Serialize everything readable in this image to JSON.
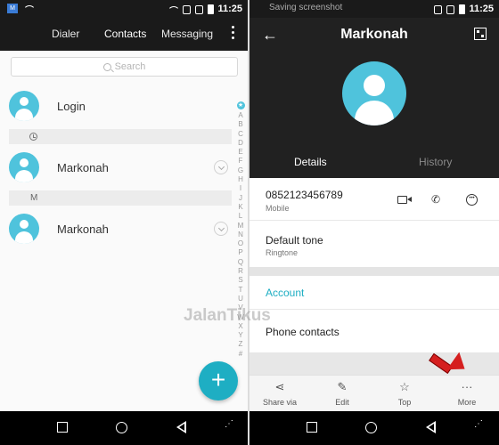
{
  "left": {
    "status": {
      "time": "11:25",
      "badge": "M"
    },
    "tabs": [
      {
        "label": "Dialer"
      },
      {
        "label": "Contacts"
      },
      {
        "label": "Messaging"
      }
    ],
    "search_placeholder": "Search",
    "contacts": [
      {
        "name": "Login"
      },
      {
        "name": "Markonah"
      },
      {
        "name": "Markonah"
      }
    ],
    "section_m": "M",
    "index_letters": "ABCDEFGHIJKLMNOPQRSTUVWXYZ#",
    "fab": "+"
  },
  "right": {
    "status": {
      "time": "11:25",
      "notice": "Saving screenshot"
    },
    "title": "Markonah",
    "tabs": {
      "details": "Details",
      "history": "History"
    },
    "phone": {
      "number": "0852123456789",
      "type": "Mobile"
    },
    "tone": {
      "label": "Default tone",
      "sub": "Ringtone"
    },
    "account_header": "Account",
    "account_value": "Phone contacts",
    "actions": [
      {
        "label": "Share via",
        "icon": "share-icon"
      },
      {
        "label": "Edit",
        "icon": "edit-icon"
      },
      {
        "label": "Top",
        "icon": "star-icon"
      },
      {
        "label": "More",
        "icon": "more-icon"
      }
    ]
  },
  "watermark": "JalanTikus",
  "colors": {
    "accent": "#1eaec3",
    "avatar": "#4fc3dc",
    "header_dark": "#212121",
    "arrow": "#d51f1f"
  }
}
